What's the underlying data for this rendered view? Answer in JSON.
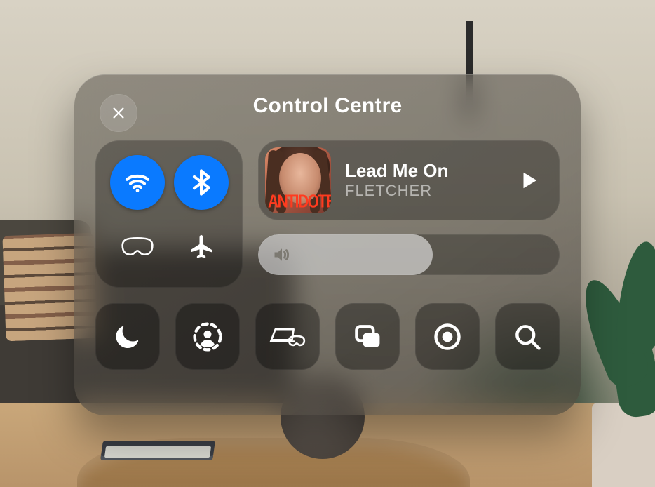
{
  "panel": {
    "title": "Control Centre"
  },
  "connectivity": {
    "wifi": {
      "active": true
    },
    "bluetooth": {
      "active": true
    },
    "travel_mode": {
      "active": false
    },
    "airplane_mode": {
      "active": false
    }
  },
  "now_playing": {
    "track_title": "Lead Me On",
    "artist": "FLETCHER",
    "album_tag": "ANTIDOTE",
    "is_playing": false
  },
  "volume": {
    "level_percent": 58
  },
  "tiles": {
    "focus": "Focus",
    "guest_user": "Guest User",
    "mac_virtual_display": "Mac Virtual Display",
    "screen_mirroring": "Screen Mirroring",
    "capture": "Capture",
    "search": "Search"
  },
  "colors": {
    "accent_active": "#0a7aff",
    "album_accent": "#ff3b1f"
  }
}
